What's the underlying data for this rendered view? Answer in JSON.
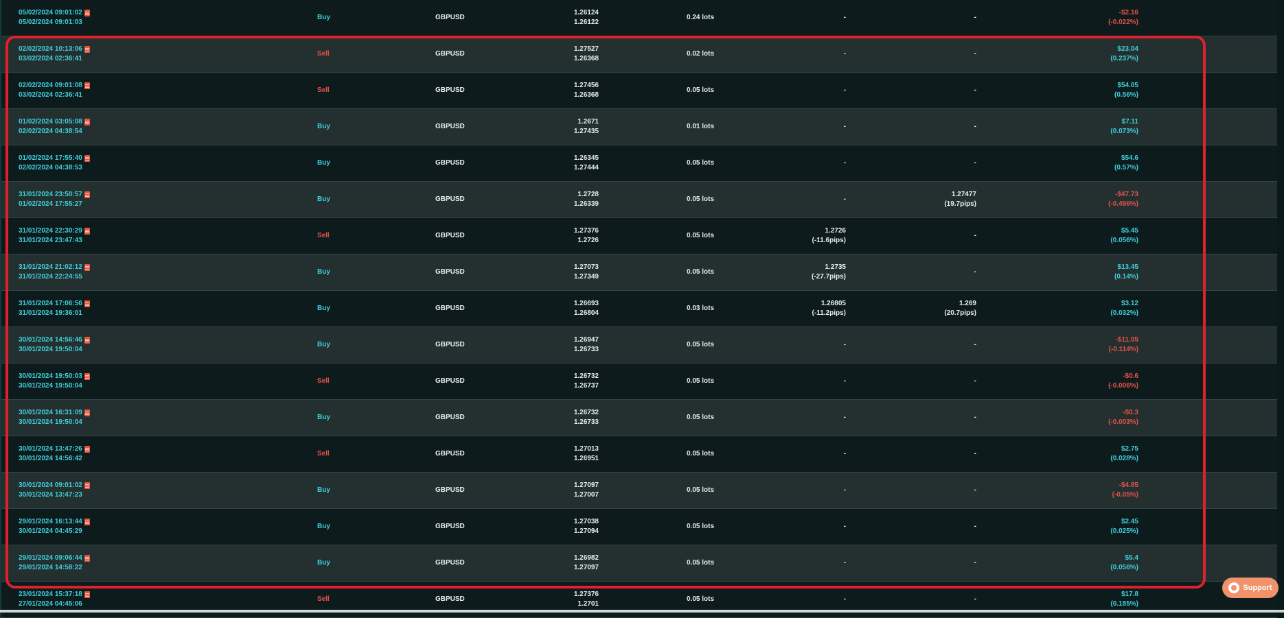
{
  "support_label": "Support",
  "colors": {
    "buy": "#3fd0dc",
    "sell": "#e5514a",
    "highlight": "#e0202a",
    "support_bg": "#f0926a"
  },
  "trades": [
    {
      "open": "05/02/2024 09:01:02",
      "close": "05/02/2024 09:01:03",
      "type": "Buy",
      "symbol": "GBPUSD",
      "open_price": "1.26124",
      "close_price": "1.26122",
      "lots": "0.24 lots",
      "sl": "-",
      "sl_pips": "",
      "tp": "-",
      "tp_pips": "",
      "pnl": "-$2.16",
      "pnl_pct": "(-0.022%)",
      "positive": false
    },
    {
      "open": "02/02/2024 10:13:06",
      "close": "03/02/2024 02:36:41",
      "type": "Sell",
      "symbol": "GBPUSD",
      "open_price": "1.27527",
      "close_price": "1.26368",
      "lots": "0.02 lots",
      "sl": "-",
      "sl_pips": "",
      "tp": "-",
      "tp_pips": "",
      "pnl": "$23.04",
      "pnl_pct": "(0.237%)",
      "positive": true
    },
    {
      "open": "02/02/2024 09:01:08",
      "close": "03/02/2024 02:36:41",
      "type": "Sell",
      "symbol": "GBPUSD",
      "open_price": "1.27456",
      "close_price": "1.26368",
      "lots": "0.05 lots",
      "sl": "-",
      "sl_pips": "",
      "tp": "-",
      "tp_pips": "",
      "pnl": "$54.05",
      "pnl_pct": "(0.56%)",
      "positive": true
    },
    {
      "open": "01/02/2024 03:05:08",
      "close": "02/02/2024 04:38:54",
      "type": "Buy",
      "symbol": "GBPUSD",
      "open_price": "1.2671",
      "close_price": "1.27435",
      "lots": "0.01 lots",
      "sl": "-",
      "sl_pips": "",
      "tp": "-",
      "tp_pips": "",
      "pnl": "$7.11",
      "pnl_pct": "(0.073%)",
      "positive": true
    },
    {
      "open": "01/02/2024 17:55:40",
      "close": "02/02/2024 04:38:53",
      "type": "Buy",
      "symbol": "GBPUSD",
      "open_price": "1.26345",
      "close_price": "1.27444",
      "lots": "0.05 lots",
      "sl": "-",
      "sl_pips": "",
      "tp": "-",
      "tp_pips": "",
      "pnl": "$54.6",
      "pnl_pct": "(0.57%)",
      "positive": true
    },
    {
      "open": "31/01/2024 23:50:57",
      "close": "01/02/2024 17:55:27",
      "type": "Buy",
      "symbol": "GBPUSD",
      "open_price": "1.2728",
      "close_price": "1.26339",
      "lots": "0.05 lots",
      "sl": "-",
      "sl_pips": "",
      "tp": "1.27477",
      "tp_pips": "(19.7pips)",
      "pnl": "-$47.73",
      "pnl_pct": "(-0.496%)",
      "positive": false
    },
    {
      "open": "31/01/2024 22:30:29",
      "close": "31/01/2024 23:47:43",
      "type": "Sell",
      "symbol": "GBPUSD",
      "open_price": "1.27376",
      "close_price": "1.2726",
      "lots": "0.05 lots",
      "sl": "1.2726",
      "sl_pips": "(-11.6pips)",
      "tp": "-",
      "tp_pips": "",
      "pnl": "$5.45",
      "pnl_pct": "(0.056%)",
      "positive": true
    },
    {
      "open": "31/01/2024 21:02:12",
      "close": "31/01/2024 22:24:55",
      "type": "Buy",
      "symbol": "GBPUSD",
      "open_price": "1.27073",
      "close_price": "1.27349",
      "lots": "0.05 lots",
      "sl": "1.2735",
      "sl_pips": "(-27.7pips)",
      "tp": "-",
      "tp_pips": "",
      "pnl": "$13.45",
      "pnl_pct": "(0.14%)",
      "positive": true
    },
    {
      "open": "31/01/2024 17:06:56",
      "close": "31/01/2024 19:36:01",
      "type": "Buy",
      "symbol": "GBPUSD",
      "open_price": "1.26693",
      "close_price": "1.26804",
      "lots": "0.03 lots",
      "sl": "1.26805",
      "sl_pips": "(-11.2pips)",
      "tp": "1.269",
      "tp_pips": "(20.7pips)",
      "pnl": "$3.12",
      "pnl_pct": "(0.032%)",
      "positive": true
    },
    {
      "open": "30/01/2024 14:56:46",
      "close": "30/01/2024 19:50:04",
      "type": "Buy",
      "symbol": "GBPUSD",
      "open_price": "1.26947",
      "close_price": "1.26733",
      "lots": "0.05 lots",
      "sl": "-",
      "sl_pips": "",
      "tp": "-",
      "tp_pips": "",
      "pnl": "-$11.05",
      "pnl_pct": "(-0.114%)",
      "positive": false
    },
    {
      "open": "30/01/2024 19:50:03",
      "close": "30/01/2024 19:50:04",
      "type": "Sell",
      "symbol": "GBPUSD",
      "open_price": "1.26732",
      "close_price": "1.26737",
      "lots": "0.05 lots",
      "sl": "-",
      "sl_pips": "",
      "tp": "-",
      "tp_pips": "",
      "pnl": "-$0.6",
      "pnl_pct": "(-0.006%)",
      "positive": false
    },
    {
      "open": "30/01/2024 16:31:09",
      "close": "30/01/2024 19:50:04",
      "type": "Buy",
      "symbol": "GBPUSD",
      "open_price": "1.26732",
      "close_price": "1.26733",
      "lots": "0.05 lots",
      "sl": "-",
      "sl_pips": "",
      "tp": "-",
      "tp_pips": "",
      "pnl": "-$0.3",
      "pnl_pct": "(-0.003%)",
      "positive": false
    },
    {
      "open": "30/01/2024 13:47:26",
      "close": "30/01/2024 14:56:42",
      "type": "Sell",
      "symbol": "GBPUSD",
      "open_price": "1.27013",
      "close_price": "1.26951",
      "lots": "0.05 lots",
      "sl": "-",
      "sl_pips": "",
      "tp": "-",
      "tp_pips": "",
      "pnl": "$2.75",
      "pnl_pct": "(0.028%)",
      "positive": true
    },
    {
      "open": "30/01/2024 09:01:02",
      "close": "30/01/2024 13:47:23",
      "type": "Buy",
      "symbol": "GBPUSD",
      "open_price": "1.27097",
      "close_price": "1.27007",
      "lots": "0.05 lots",
      "sl": "-",
      "sl_pips": "",
      "tp": "-",
      "tp_pips": "",
      "pnl": "-$4.85",
      "pnl_pct": "(-0.05%)",
      "positive": false
    },
    {
      "open": "29/01/2024 16:13:44",
      "close": "30/01/2024 04:45:29",
      "type": "Buy",
      "symbol": "GBPUSD",
      "open_price": "1.27038",
      "close_price": "1.27094",
      "lots": "0.05 lots",
      "sl": "-",
      "sl_pips": "",
      "tp": "-",
      "tp_pips": "",
      "pnl": "$2.45",
      "pnl_pct": "(0.025%)",
      "positive": true
    },
    {
      "open": "29/01/2024 09:06:44",
      "close": "29/01/2024 14:58:22",
      "type": "Buy",
      "symbol": "GBPUSD",
      "open_price": "1.26982",
      "close_price": "1.27097",
      "lots": "0.05 lots",
      "sl": "-",
      "sl_pips": "",
      "tp": "-",
      "tp_pips": "",
      "pnl": "$5.4",
      "pnl_pct": "(0.056%)",
      "positive": true
    },
    {
      "open": "23/01/2024 15:37:18",
      "close": "27/01/2024 04:45:06",
      "type": "Sell",
      "symbol": "GBPUSD",
      "open_price": "1.27376",
      "close_price": "1.2701",
      "lots": "0.05 lots",
      "sl": "-",
      "sl_pips": "",
      "tp": "-",
      "tp_pips": "",
      "pnl": "$17.8",
      "pnl_pct": "(0.185%)",
      "positive": true
    }
  ]
}
